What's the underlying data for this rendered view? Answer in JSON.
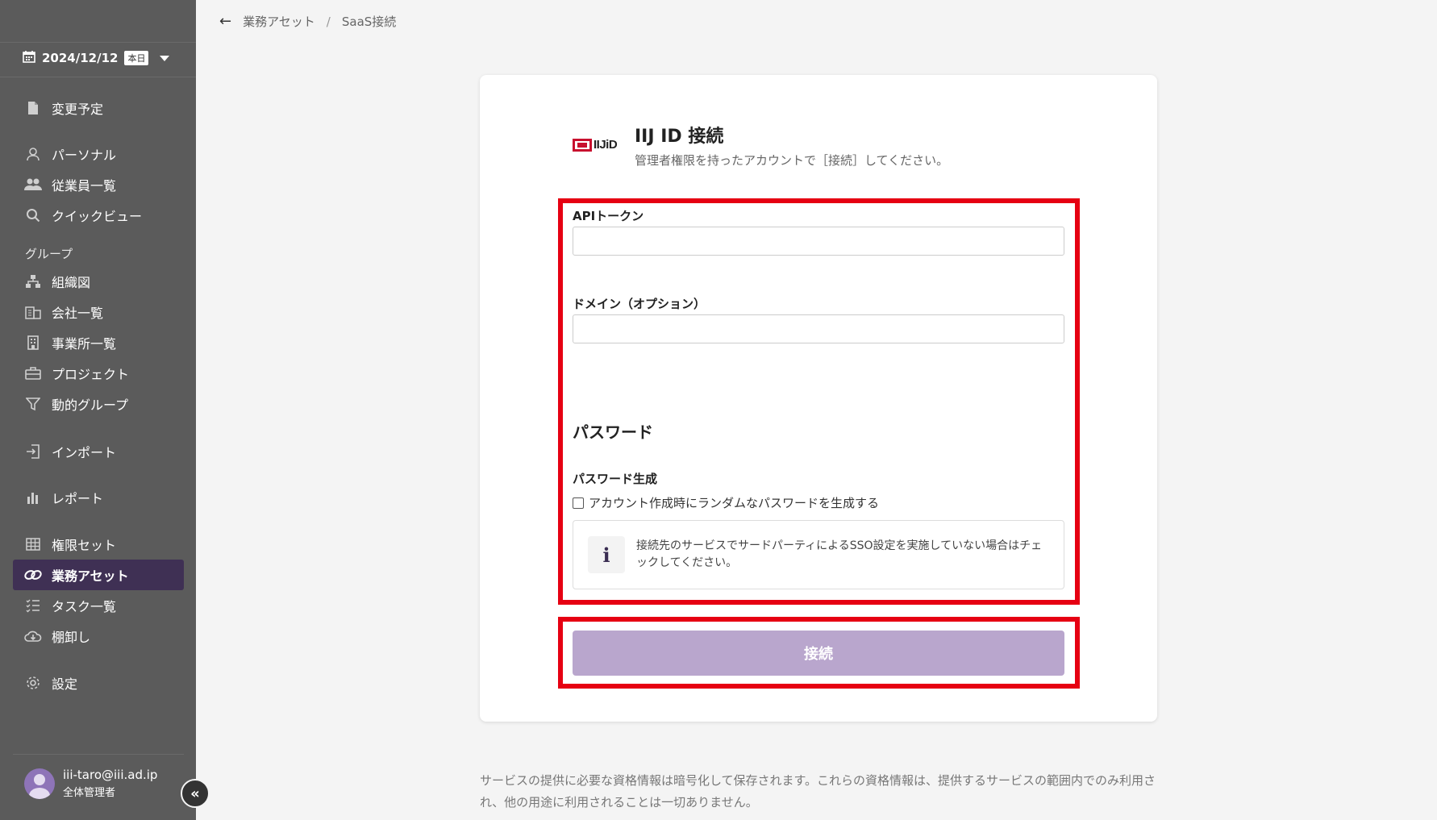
{
  "sidebar": {
    "date": "2024/12/12",
    "date_badge": "本日",
    "items": [
      {
        "label": "変更予定",
        "icon": "document-icon"
      },
      {
        "label": "パーソナル",
        "icon": "person-icon"
      },
      {
        "label": "従業員一覧",
        "icon": "people-icon"
      },
      {
        "label": "クイックビュー",
        "icon": "search-icon"
      },
      {
        "label": "組織図",
        "icon": "org-chart-icon"
      },
      {
        "label": "会社一覧",
        "icon": "building-icon"
      },
      {
        "label": "事業所一覧",
        "icon": "office-icon"
      },
      {
        "label": "プロジェクト",
        "icon": "briefcase-icon"
      },
      {
        "label": "動的グループ",
        "icon": "filter-icon"
      },
      {
        "label": "インポート",
        "icon": "import-icon"
      },
      {
        "label": "レポート",
        "icon": "bar-chart-icon"
      },
      {
        "label": "権限セット",
        "icon": "grid-icon"
      },
      {
        "label": "業務アセット",
        "icon": "link-icon"
      },
      {
        "label": "タスク一覧",
        "icon": "checklist-icon"
      },
      {
        "label": "棚卸し",
        "icon": "cloud-download-icon"
      },
      {
        "label": "設定",
        "icon": "gear-icon"
      }
    ],
    "group_label": "グループ",
    "user": {
      "email": "iii-taro@iii.ad.ip",
      "role": "全体管理者"
    },
    "collapse_label": "«"
  },
  "breadcrumb": {
    "back": "←",
    "items": [
      "業務アセット",
      "SaaS接続"
    ],
    "separator": "/"
  },
  "card": {
    "logo_text": "IIJiD",
    "title": "IIJ ID 接続",
    "subtitle": "管理者権限を持ったアカウントで［接続］してください。",
    "api_token_label": "APIトークン",
    "domain_label": "ドメイン（オプション）",
    "password_section": "パスワード",
    "password_gen_label": "パスワード生成",
    "password_checkbox_label": "アカウント作成時にランダムなパスワードを生成する",
    "info_icon": "i",
    "info_text": "接続先のサービスでサードパーティによるSSO設定を実施していない場合はチェックしてください。",
    "connect_button": "接続"
  },
  "footer_note": "サービスの提供に必要な資格情報は暗号化して保存されます。これらの資格情報は、提供するサービスの範囲内でのみ利用され、他の用途に利用されることは一切ありません。",
  "colors": {
    "sidebar": "#5b5b5b",
    "active": "#3f3054",
    "highlight": "#e60012",
    "button": "#b9a6cd"
  }
}
